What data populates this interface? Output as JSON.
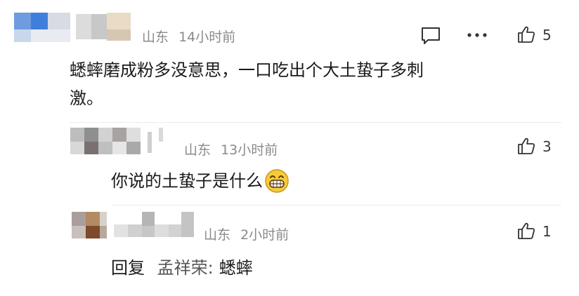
{
  "comments": [
    {
      "location": "山东",
      "time": "14小时前",
      "text_line1": "蟋蟀磨成粉多没意思，一口吃出个大土蛰子多刺",
      "text_line2": "激。",
      "likes": "5"
    },
    {
      "location": "山东",
      "time": "13小时前",
      "text": "你说的土蛰子是什么",
      "emoji": "grinning-face-emoji",
      "likes": "3"
    },
    {
      "location": "山东",
      "time": "2小时前",
      "reply_prefix": "回复",
      "reply_to": "孟祥荣",
      "reply_colon": ":",
      "reply_text": "蟋蟀",
      "likes": "1"
    }
  ],
  "icons": {
    "comment": "comment-icon",
    "more": "more-icon",
    "like": "thumbs-up-icon"
  },
  "colors": {
    "meta": "#8a8a8a",
    "text": "#1a1a1a"
  }
}
